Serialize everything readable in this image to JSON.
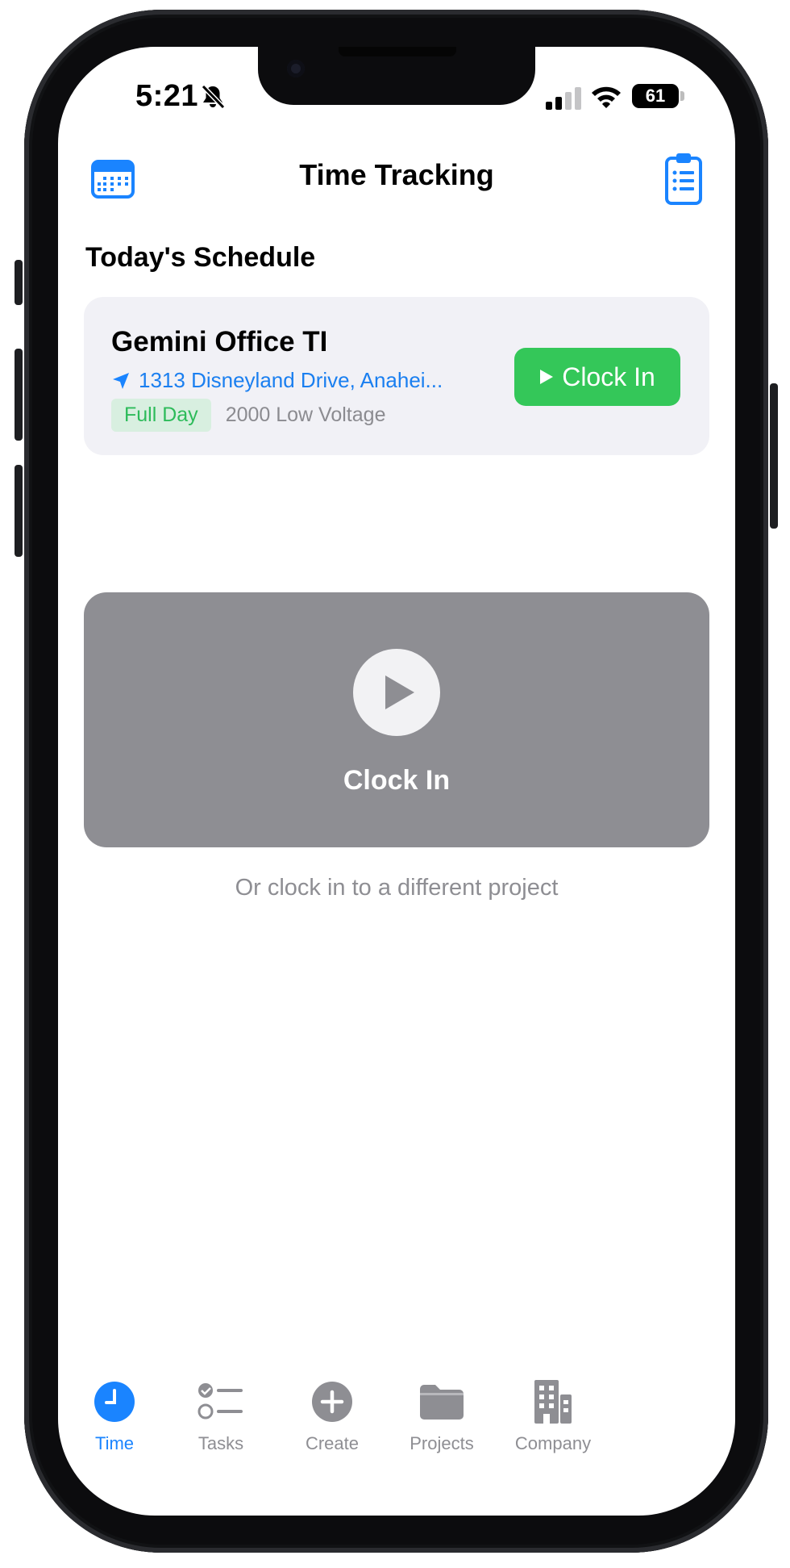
{
  "status_bar": {
    "time": "5:21",
    "battery": "61"
  },
  "nav": {
    "title": "Time Tracking",
    "left_icon": "calendar-icon",
    "right_icon": "clipboard-list-icon"
  },
  "schedule": {
    "section_title": "Today's Schedule",
    "card": {
      "title": "Gemini Office TI",
      "address": "1313 Disneyland Drive, Anahei...",
      "badge": "Full Day",
      "subtitle": "2000 Low Voltage",
      "button_label": "Clock In"
    }
  },
  "clock_in": {
    "label": "Clock In",
    "hint": "Or clock in to a different project"
  },
  "tabs": [
    {
      "label": "Time",
      "icon": "clock-icon",
      "active": true
    },
    {
      "label": "Tasks",
      "icon": "tasks-icon",
      "active": false
    },
    {
      "label": "Create",
      "icon": "plus-circle-icon",
      "active": false
    },
    {
      "label": "Projects",
      "icon": "folder-icon",
      "active": false
    },
    {
      "label": "Company",
      "icon": "building-icon",
      "active": false
    }
  ],
  "colors": {
    "accent_blue": "#1a84ff",
    "green": "#34c759",
    "gray_card": "#8e8e93",
    "light_card": "#f1f1f6"
  }
}
